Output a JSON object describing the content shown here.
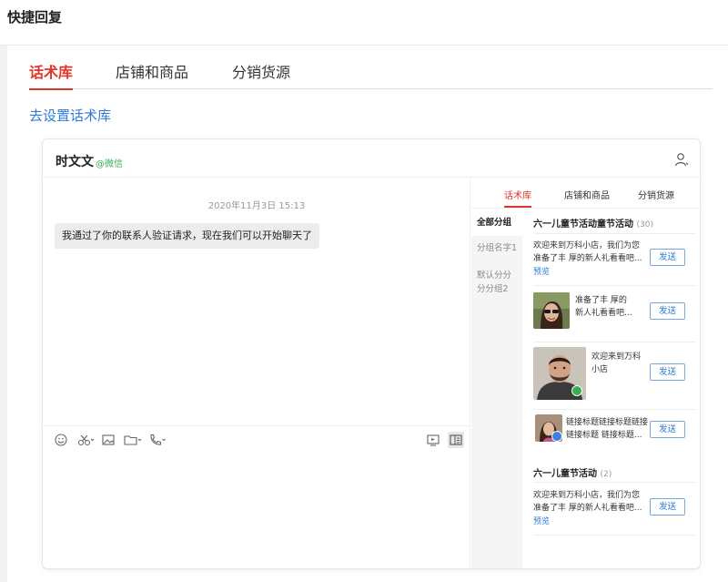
{
  "page_title": "快捷回复",
  "tabs": [
    {
      "label": "话术库",
      "active": true
    },
    {
      "label": "店铺和商品",
      "active": false
    },
    {
      "label": "分销货源",
      "active": false
    }
  ],
  "setup_link": "去设置话术库",
  "chat": {
    "contact_name": "时文文",
    "contact_source": "@微信",
    "timestamp": "2020年11月3日 15:13",
    "message": "我通过了你的联系人验证请求，现在我们可以开始聊天了"
  },
  "toolbar_icons": [
    "emoji-icon",
    "scissors-icon",
    "image-icon",
    "folder-icon",
    "phone-icon",
    "screen-icon",
    "panel-toggle-icon"
  ],
  "side_panel": {
    "tabs": [
      {
        "label": "话术库",
        "active": true
      },
      {
        "label": "店铺和商品",
        "active": false
      },
      {
        "label": "分销货源",
        "active": false
      }
    ],
    "groups": [
      {
        "label": "全部分组",
        "active": true
      },
      {
        "label": "分组名字1",
        "active": false
      },
      {
        "label": "默认分分分分组2",
        "active": false
      }
    ],
    "section1": {
      "title": "六一儿童节活动童节活动",
      "count": "(30)",
      "items": [
        {
          "text_l1": "欢迎来到万科小店，我们为您",
          "text_l2": "准备了丰 厚的新人礼看看吧...",
          "preview": "预览",
          "send": "发送"
        },
        {
          "text_l1": "准备了丰 厚的",
          "text_l2": "新人礼看看吧...",
          "send": "发送"
        },
        {
          "text_l1": "欢迎来到万科",
          "text_l2": "小店",
          "send": "发送"
        },
        {
          "text_l1": "链接标题链接标题链接",
          "text_l2": "链接标题 链接标题...",
          "send": "发送"
        }
      ]
    },
    "section2": {
      "title": "六一儿童节活动",
      "count": "(2)",
      "items": [
        {
          "text_l1": "欢迎来到万科小店，我们为您",
          "text_l2": "准备了丰 厚的新人礼看看吧...",
          "preview": "预览",
          "send": "发送"
        }
      ]
    }
  },
  "colors": {
    "accent_red": "#e0352b",
    "link_blue": "#2f7bd8",
    "wechat_green": "#3cae4f"
  }
}
